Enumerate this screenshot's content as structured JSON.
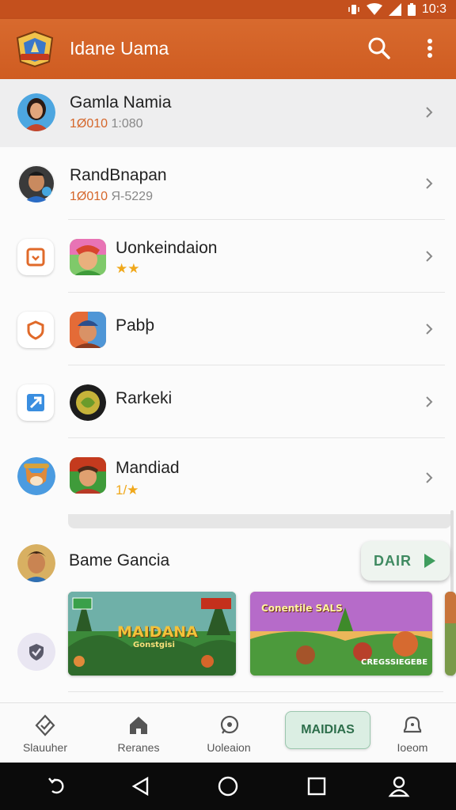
{
  "status_bar": {
    "time": "10:3"
  },
  "app_bar": {
    "title": "Idane Uama",
    "logo_icon": "game-crest-logo",
    "search_icon": "search-icon",
    "menu_icon": "more-vert-icon"
  },
  "list": [
    {
      "title": "Gamla Namia",
      "sub_accent": "1Ø010",
      "sub_rest": " 1:080",
      "avatar": "woman-avatar"
    },
    {
      "title": "RandBnapan",
      "sub_accent": "1Ø010",
      "sub_rest": " Я-5229",
      "avatar": "man-avatar"
    },
    {
      "title": "Uonkeindaion",
      "stars": "★★",
      "tile": "orange-square-icon",
      "game": "elf-game-icon"
    },
    {
      "title": "Pabþ",
      "tile": "orange-shield-icon",
      "game": "knight-game-icon"
    },
    {
      "title": "Rarkeki",
      "tile": "blue-arrow-icon",
      "game": "dark-orb-game-icon"
    },
    {
      "title": "Mandiad",
      "stars": "1/★",
      "tile": "fox-avatar-icon",
      "game": "hero-game-icon"
    }
  ],
  "section": {
    "title": "Bame Gancia",
    "button_label": "DAIR",
    "banner1_title": "MAIDANA",
    "banner1_sub": "Gonstgisi",
    "banner2_title": "Conentile SALS",
    "banner2_sub": "CREGSSIEGEBE"
  },
  "bottom_nav": [
    {
      "label": "Slauuher",
      "icon": "shield-check-icon"
    },
    {
      "label": "Reranes",
      "icon": "home-icon"
    },
    {
      "label": "Uoleaion",
      "icon": "chat-bubble-icon"
    },
    {
      "label": "MAIDIAS",
      "icon": "active-tab"
    },
    {
      "label": "Ioeom",
      "icon": "bell-icon"
    }
  ],
  "colors": {
    "primary": "#cf5c21",
    "accent_green": "#3f8a61",
    "star": "#f0a81b"
  }
}
